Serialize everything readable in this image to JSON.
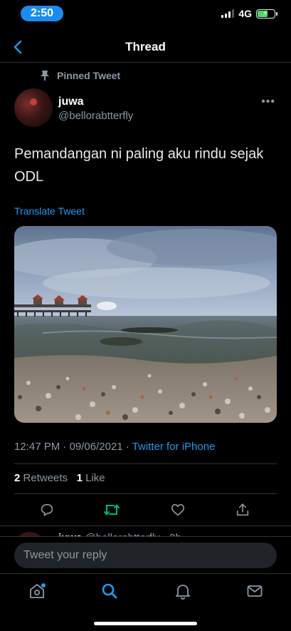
{
  "status": {
    "time": "2:50",
    "network": "4G"
  },
  "nav": {
    "title": "Thread"
  },
  "tweet": {
    "pinned_label": "Pinned Tweet",
    "author_name": "juwa",
    "author_handle": "@bellorabtterfly",
    "text": "Pemandangan ni paling aku rindu sejak ODL",
    "translate_label": "Translate Tweet",
    "time": "12:47 PM",
    "date": "09/06/2021",
    "source": "Twitter for iPhone",
    "retweets_count": "2",
    "retweets_label": "Retweets",
    "likes_count": "1",
    "likes_label": "Like"
  },
  "reply_preview": {
    "name": "juwa",
    "handle_time": "@bellorabtterfly · 2h"
  },
  "reply_bar": {
    "placeholder": "Tweet your reply"
  },
  "colors": {
    "accent": "#1d9bf0",
    "retweet_green": "#00ba7c",
    "muted": "#8b98a5",
    "background": "#000000"
  },
  "icons": [
    "chevron-left-icon",
    "pin-icon",
    "more-icon",
    "reply-icon",
    "retweet-icon",
    "like-icon",
    "share-icon",
    "home-icon",
    "search-icon",
    "notifications-icon",
    "messages-icon"
  ]
}
